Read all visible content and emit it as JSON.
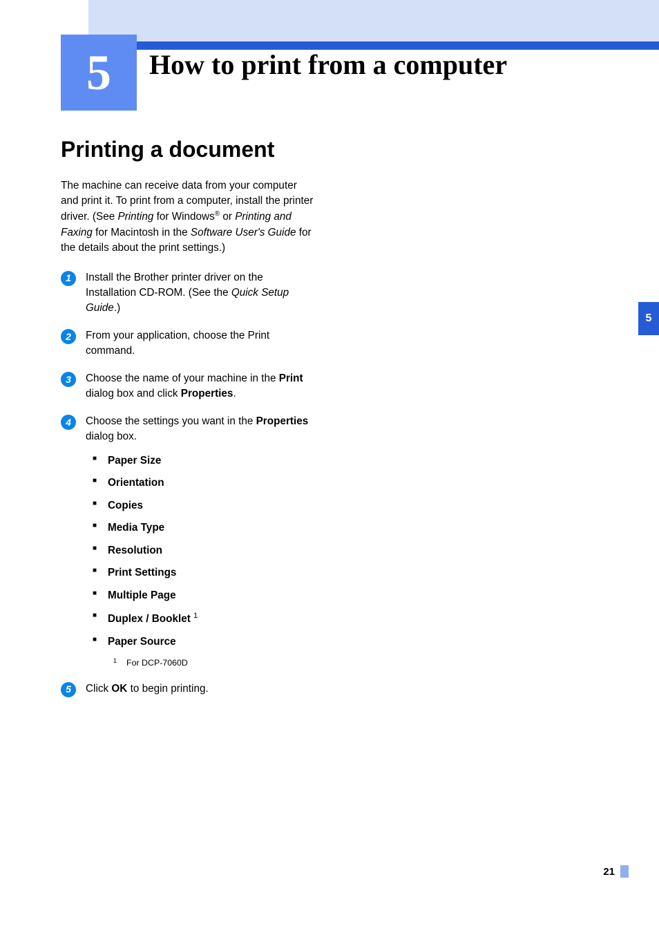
{
  "chapter": {
    "number": "5",
    "title": "How to print from a computer"
  },
  "section": {
    "heading": "Printing a document"
  },
  "intro": {
    "t1": "The machine can receive data from your computer and print it. To print from a computer, install the printer driver. (See ",
    "i1": "Printing",
    "t2": " for Windows",
    "reg": "®",
    "t3": " or ",
    "i2": "Printing and Faxing",
    "t4": " for Macintosh in the ",
    "i3": "Software User's Guide",
    "t5": " for the details about the print settings.)"
  },
  "steps": {
    "s1": {
      "num": "1",
      "a": "Install the Brother printer driver on the Installation CD-ROM. (See the ",
      "i": "Quick Setup Guide",
      "b": ".)"
    },
    "s2": {
      "num": "2",
      "a": "From your application, choose the Print command."
    },
    "s3": {
      "num": "3",
      "a": "Choose the name of your machine in the ",
      "b1": "Print",
      "c": " dialog box and click ",
      "b2": "Properties",
      "d": "."
    },
    "s4": {
      "num": "4",
      "a": "Choose the settings you want in the ",
      "b1": "Properties",
      "c": " dialog box."
    },
    "s5": {
      "num": "5",
      "a": "Click ",
      "b1": "OK",
      "c": " to begin printing."
    }
  },
  "props": {
    "p1": "Paper Size",
    "p2": "Orientation",
    "p3": "Copies",
    "p4": "Media Type",
    "p5": "Resolution",
    "p6": "Print Settings",
    "p7": "Multiple Page",
    "p8": "Duplex / Booklet",
    "p8_fn": "1",
    "p9": "Paper Source"
  },
  "footnote": {
    "mark": "1",
    "text": "For DCP-7060D"
  },
  "sidetab": "5",
  "pagenum": "21"
}
